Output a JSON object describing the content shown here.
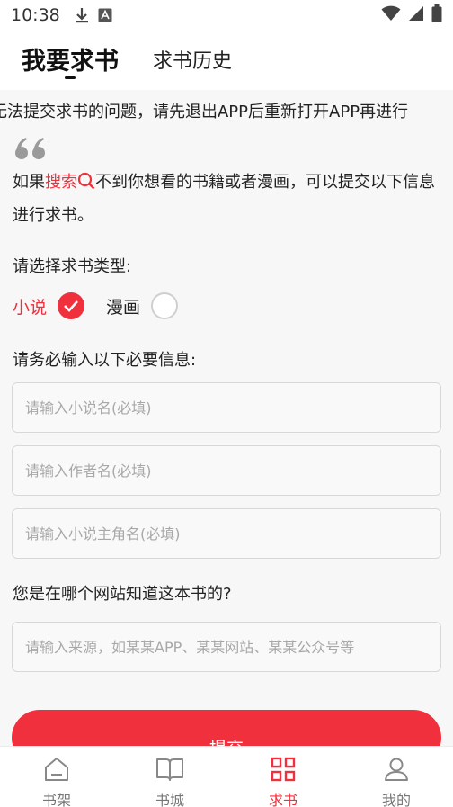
{
  "status_bar": {
    "time": "10:38"
  },
  "tabs": [
    {
      "label": "我要求书",
      "active": true
    },
    {
      "label": "求书历史",
      "active": false
    }
  ],
  "notice": "无法提交求书的问题，请先退出APP后重新打开APP再进行",
  "intro": {
    "prefix": "如果",
    "link": "搜索",
    "suffix": "不到你想看的书籍或者漫画，可以提交以下信息进行求书。"
  },
  "type_section": {
    "label": "请选择求书类型:",
    "options": [
      {
        "label": "小说",
        "selected": true
      },
      {
        "label": "漫画",
        "selected": false
      }
    ]
  },
  "info_section": {
    "label": "请务必输入以下必要信息:",
    "fields": [
      {
        "placeholder": "请输入小说名(必填)",
        "value": ""
      },
      {
        "placeholder": "请输入作者名(必填)",
        "value": ""
      },
      {
        "placeholder": "请输入小说主角名(必填)",
        "value": ""
      }
    ]
  },
  "source_section": {
    "label": "您是在哪个网站知道这本书的?",
    "placeholder": "请输入来源，如某某APP、某某网站、某某公众号等",
    "value": ""
  },
  "submit_label": "提交",
  "bottom_nav": [
    {
      "label": "书架",
      "icon": "bookshelf-icon",
      "active": false
    },
    {
      "label": "书城",
      "icon": "book-icon",
      "active": false
    },
    {
      "label": "求书",
      "icon": "grid-icon",
      "active": true
    },
    {
      "label": "我的",
      "icon": "user-icon",
      "active": false
    }
  ],
  "colors": {
    "accent": "#f0303c",
    "background": "#f7f7f7"
  }
}
